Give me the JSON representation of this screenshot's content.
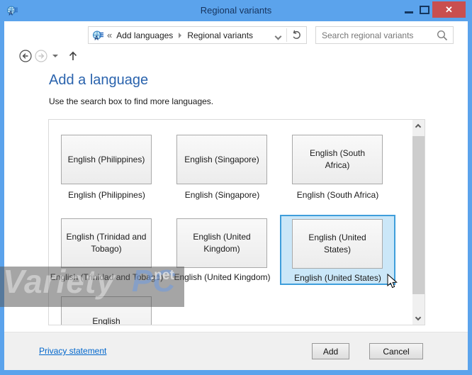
{
  "window": {
    "title": "Regional variants"
  },
  "titlebar": {
    "minimize": "minimize",
    "maximize": "maximize",
    "close": "✕"
  },
  "toolbar": {
    "breadcrumb": {
      "overflow": "«",
      "root": "Add languages",
      "current": "Regional variants"
    },
    "search": {
      "placeholder": "Search regional variants"
    }
  },
  "main": {
    "heading": "Add a language",
    "subheading": "Use the search box to find more languages."
  },
  "tiles": [
    {
      "label": "English (Philippines)",
      "caption": "English (Philippines)"
    },
    {
      "label": "English (Singapore)",
      "caption": "English (Singapore)"
    },
    {
      "label": "English (South Africa)",
      "caption": "English (South Africa)"
    },
    {
      "label": "English (Trinidad and Tobago)",
      "caption": "English (Trinidad and Tobago)"
    },
    {
      "label": "English (United Kingdom)",
      "caption": "English (United Kingdom)"
    },
    {
      "label": "English (United States)",
      "caption": "English (United States)",
      "selected": true
    },
    {
      "label": "English",
      "caption": ""
    }
  ],
  "footer": {
    "privacy_link": "Privacy statement",
    "add_label": "Add",
    "cancel_label": "Cancel"
  },
  "watermark": {
    "part1": "Variety",
    "part2": "PC",
    "part3": ".net"
  },
  "appearance": {
    "accent_blue": "#5ba3ec",
    "close_red": "#c94f4f",
    "heading_blue": "#2a63ad",
    "selection_fill": "#cbe7f8",
    "selection_border": "#3f9edb",
    "link_blue": "#0066cc"
  }
}
